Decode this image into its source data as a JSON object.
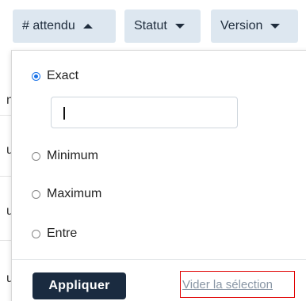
{
  "filters": {
    "attendu_label": "# attendu",
    "statut_label": "Statut",
    "version_label": "Version"
  },
  "background": {
    "row_chars": [
      "n",
      "u",
      "u",
      "u"
    ]
  },
  "panel": {
    "options": {
      "exact": "Exact",
      "minimum": "Minimum",
      "maximum": "Maximum",
      "entre": "Entre"
    },
    "selected": "exact",
    "input_value": "",
    "apply_label": "Appliquer",
    "clear_label": "Vider la sélection"
  },
  "colors": {
    "chip_bg": "#dde7f0",
    "apply_bg": "#1a2b40",
    "radio_accent": "#1a73e8",
    "highlight_border": "#e00000"
  }
}
